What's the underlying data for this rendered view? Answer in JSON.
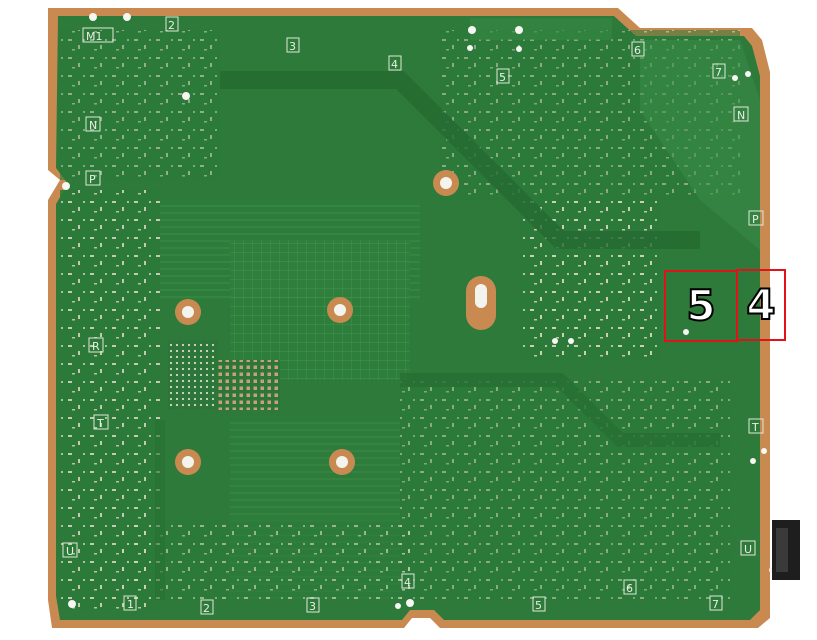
{
  "board": {
    "silkscreen_labels": {
      "m1": "M1",
      "n": "N",
      "p": "P",
      "r": "R",
      "t": "T",
      "u": "U",
      "n1": "1",
      "n2": "2",
      "n3": "3",
      "n4": "4",
      "n5": "5",
      "n6": "6",
      "n7": "7"
    },
    "colors": {
      "board_edge": "#c98a52",
      "board_green": "#2d7a3a",
      "callout_border": "#e0131a"
    }
  },
  "callouts": {
    "left_label": "5",
    "right_label": "4"
  }
}
